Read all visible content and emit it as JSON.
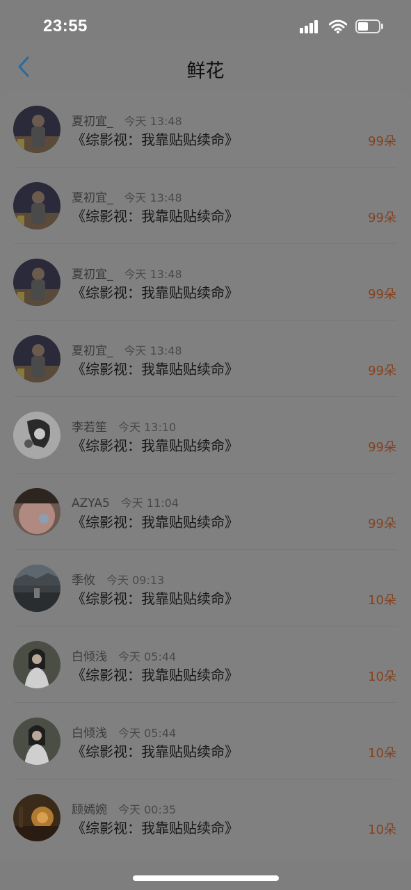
{
  "status_bar": {
    "time": "23:55",
    "icons": [
      "signal-icon",
      "wifi-icon",
      "battery-icon"
    ]
  },
  "nav": {
    "title": "鲜花",
    "back_icon": "chevron-left-icon",
    "accent_color": "#2a6a9a"
  },
  "colors": {
    "count_color": "#86411f",
    "background": "#7f7f7f"
  },
  "gifts": [
    {
      "user": "夏初宜_",
      "time": "今天 13:48",
      "book": "《综影视：我靠贴贴续命》",
      "count": "99朵",
      "avatar": "avatar-man-dark"
    },
    {
      "user": "夏初宜_",
      "time": "今天 13:48",
      "book": "《综影视：我靠贴贴续命》",
      "count": "99朵",
      "avatar": "avatar-man-dark"
    },
    {
      "user": "夏初宜_",
      "time": "今天 13:48",
      "book": "《综影视：我靠贴贴续命》",
      "count": "99朵",
      "avatar": "avatar-man-dark"
    },
    {
      "user": "夏初宜_",
      "time": "今天 13:48",
      "book": "《综影视：我靠贴贴续命》",
      "count": "99朵",
      "avatar": "avatar-man-dark"
    },
    {
      "user": "李若笙",
      "time": "今天 13:10",
      "book": "《综影视：我靠贴贴续命》",
      "count": "99朵",
      "avatar": "avatar-sketch"
    },
    {
      "user": "AZYA5",
      "time": "今天 11:04",
      "book": "《综影视：我靠贴贴续命》",
      "count": "99朵",
      "avatar": "avatar-face"
    },
    {
      "user": "季攸",
      "time": "今天 09:13",
      "book": "《综影视：我靠贴贴续命》",
      "count": "10朵",
      "avatar": "avatar-landscape"
    },
    {
      "user": "白倾浅",
      "time": "今天 05:44",
      "book": "《综影视：我靠贴贴续命》",
      "count": "10朵",
      "avatar": "avatar-woman-white"
    },
    {
      "user": "白倾浅",
      "time": "今天 05:44",
      "book": "《综影视：我靠贴贴续命》",
      "count": "10朵",
      "avatar": "avatar-woman-white"
    },
    {
      "user": "顾嫣婉",
      "time": "今天 00:35",
      "book": "《综影视：我靠贴贴续命》",
      "count": "10朵",
      "avatar": "avatar-sunset"
    }
  ]
}
